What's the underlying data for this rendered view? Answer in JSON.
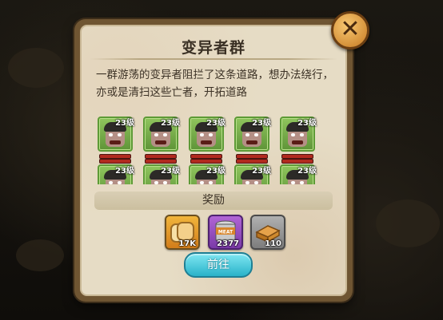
{
  "dialog": {
    "title": "变异者群",
    "description": "一群游荡的变异者阻拦了这条道路，想办法绕行，亦或是清扫这些亡者，开拓道路",
    "enemy_level": "23级",
    "reward_label": "奖励",
    "go_button": "前往",
    "close_icon": "close-icon"
  },
  "rewards": [
    {
      "icon": "bread-icon",
      "count": "17K"
    },
    {
      "icon": "meat-can-icon",
      "label": "MEAT",
      "count": "2377"
    },
    {
      "icon": "wood-planks-icon",
      "count": "110"
    }
  ],
  "colors": {
    "panel_bg": "#e6dcc5",
    "enemy_frame": "#5d9a36",
    "hp_bar": "#b22a1f",
    "go_button": "#29b2c9",
    "close_button": "#c67922"
  }
}
